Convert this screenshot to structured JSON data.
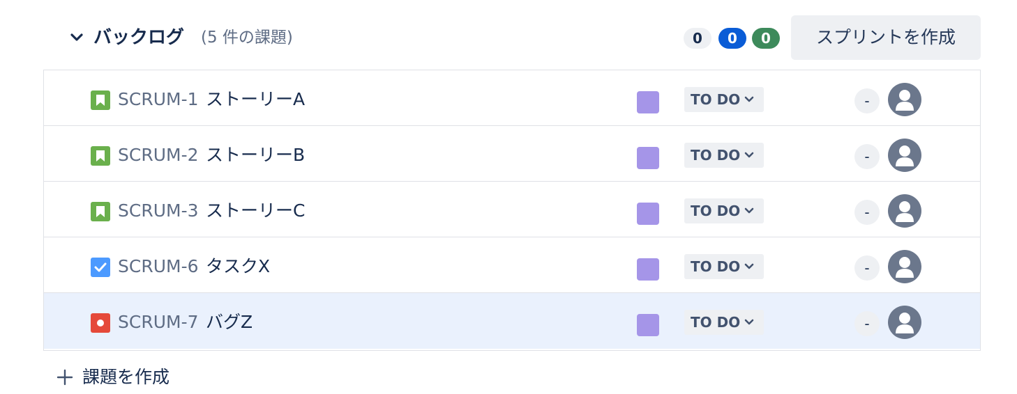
{
  "backlog": {
    "title": "バックログ",
    "count_label": "(5 件の課題)",
    "counts": {
      "todo": "0",
      "in_progress": "0",
      "done": "0"
    },
    "create_sprint_label": "スプリントを作成"
  },
  "issues": [
    {
      "key": "SCRUM-1",
      "summary": "ストーリーA",
      "type": "story",
      "status": "TO DO",
      "estimate": "-"
    },
    {
      "key": "SCRUM-2",
      "summary": "ストーリーB",
      "type": "story",
      "status": "TO DO",
      "estimate": "-"
    },
    {
      "key": "SCRUM-3",
      "summary": "ストーリーC",
      "type": "story",
      "status": "TO DO",
      "estimate": "-"
    },
    {
      "key": "SCRUM-6",
      "summary": "タスクX",
      "type": "task",
      "status": "TO DO",
      "estimate": "-"
    },
    {
      "key": "SCRUM-7",
      "summary": "バグZ",
      "type": "bug",
      "status": "TO DO",
      "estimate": "-"
    }
  ],
  "footer": {
    "create_issue_label": "課題を作成"
  },
  "colors": {
    "story": "#6ab04c",
    "task": "#4c9aff",
    "bug": "#e5493a",
    "epic": "#a595e8",
    "selected_row": "#eaf1fd"
  }
}
